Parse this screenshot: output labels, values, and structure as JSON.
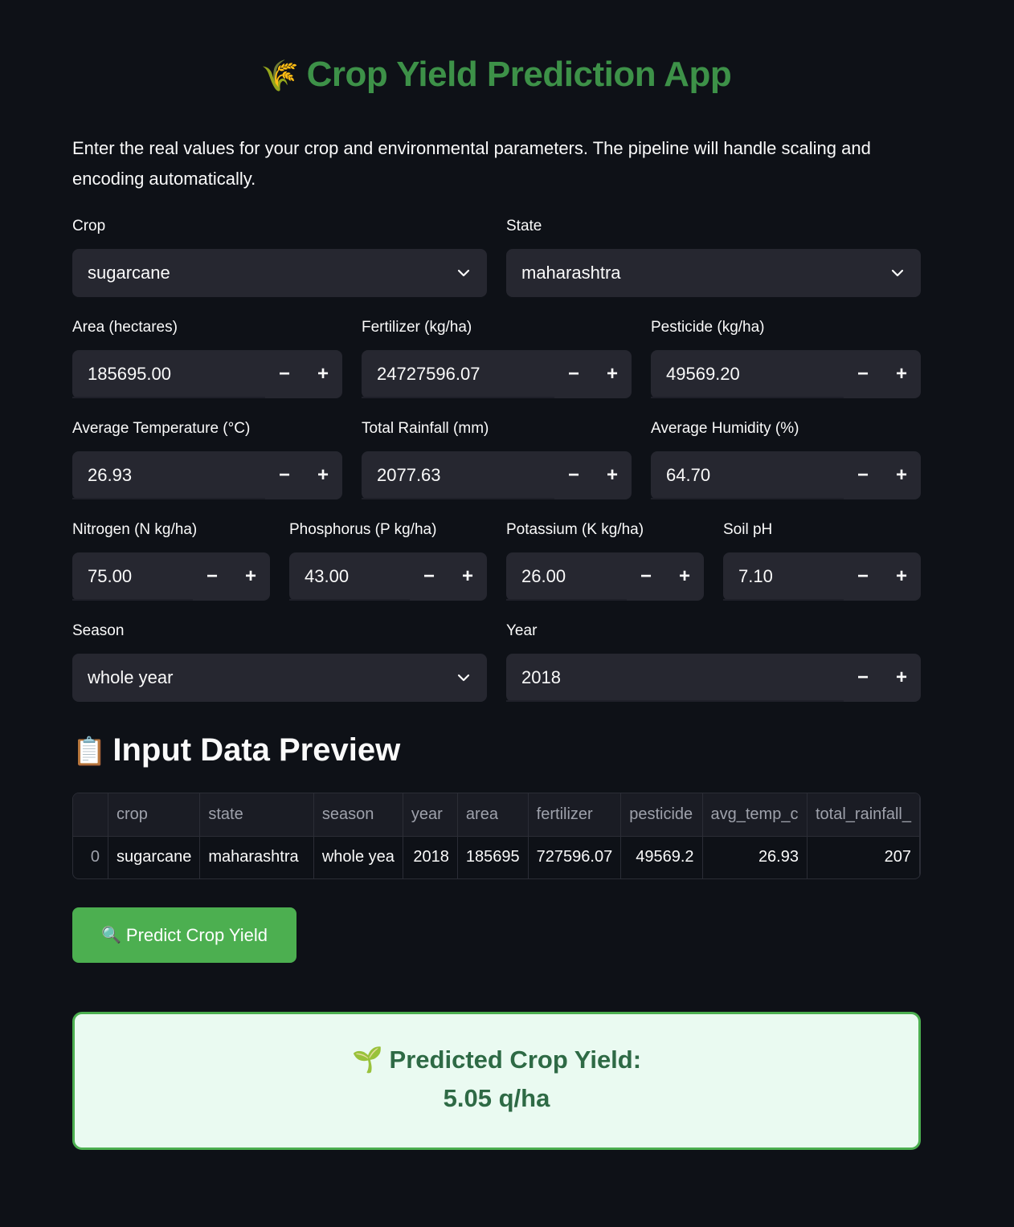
{
  "header": {
    "title_emoji": "🌾",
    "title": "Crop Yield Prediction App",
    "intro": "Enter the real values for your crop and environmental parameters. The pipeline will handle scaling and encoding automatically."
  },
  "form": {
    "crop": {
      "label": "Crop",
      "value": "sugarcane"
    },
    "state": {
      "label": "State",
      "value": "maharashtra"
    },
    "area": {
      "label": "Area (hectares)",
      "value": "185695.00"
    },
    "fertilizer": {
      "label": "Fertilizer (kg/ha)",
      "value": "24727596.07"
    },
    "pesticide": {
      "label": "Pesticide (kg/ha)",
      "value": "49569.20"
    },
    "avg_temp": {
      "label": "Average Temperature (°C)",
      "value": "26.93"
    },
    "total_rainfall": {
      "label": "Total Rainfall (mm)",
      "value": "2077.63"
    },
    "avg_humidity": {
      "label": "Average Humidity (%)",
      "value": "64.70"
    },
    "nitrogen": {
      "label": "Nitrogen (N kg/ha)",
      "value": "75.00"
    },
    "phosphorus": {
      "label": "Phosphorus (P kg/ha)",
      "value": "43.00"
    },
    "potassium": {
      "label": "Potassium (K kg/ha)",
      "value": "26.00"
    },
    "soil_ph": {
      "label": "Soil pH",
      "value": "7.10"
    },
    "season": {
      "label": "Season",
      "value": "whole year"
    },
    "year": {
      "label": "Year",
      "value": "2018"
    },
    "minus": "−",
    "plus": "+"
  },
  "preview": {
    "heading_emoji": "📋",
    "heading": "Input Data Preview",
    "columns": [
      "",
      "crop",
      "state",
      "season",
      "year",
      "area",
      "fertilizer",
      "pesticide",
      "avg_temp_c",
      "total_rainfall_"
    ],
    "row": [
      "0",
      "sugarcane",
      "maharashtra",
      "whole yea",
      "2018",
      "185695",
      "727596.07",
      "49569.2",
      "26.93",
      "207"
    ]
  },
  "actions": {
    "predict_emoji": "🔍",
    "predict_label": "Predict Crop Yield"
  },
  "result": {
    "emoji": "🌱",
    "label": "Predicted Crop Yield:",
    "value": "5.05 q/ha"
  },
  "colors": {
    "background": "#0e1117",
    "input_bg": "#262730",
    "accent_green": "#4caf50",
    "title_green": "#3d9148",
    "result_bg": "#eafaf1"
  }
}
